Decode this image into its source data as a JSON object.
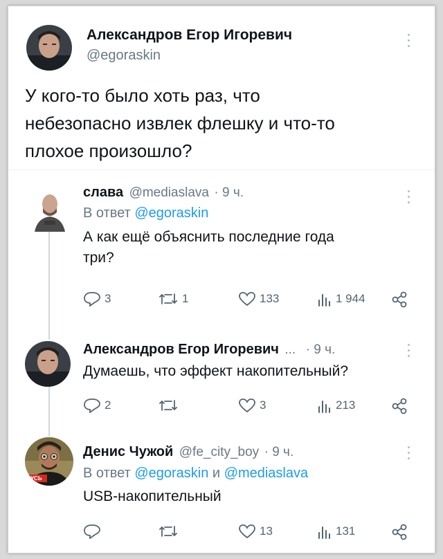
{
  "main_post": {
    "author_name": "Александров Егор Игоревич",
    "author_handle": "@egoraskin",
    "text_lines": [
      "У кого-то было хоть раз, что",
      "небезопасно извлек флешку и что-то",
      "плохое произошло?"
    ]
  },
  "replies": [
    {
      "author_name": "слава",
      "author_handle": "@mediaslava",
      "time": "· 9 ч.",
      "reply_prefix": "В ответ",
      "reply_to": "@egoraskin",
      "text_lines": [
        "А как ещё объяснить последние года",
        "три?"
      ],
      "replies_count": "3",
      "reposts_count": "1",
      "likes_count": "133",
      "views_count": "1 944"
    },
    {
      "author_name": "Александров Егор Игоревич",
      "author_ellipsis": "...",
      "time": "· 9 ч.",
      "text_lines": [
        "Думаешь, что эффект накопительный?"
      ],
      "replies_count": "2",
      "likes_count": "3",
      "views_count": "213"
    },
    {
      "author_name": "Денис Чужой",
      "author_handle": "@fe_city_boy",
      "time": "· 9 ч.",
      "reply_prefix": "В ответ",
      "reply_to": "@egoraskin",
      "reply_and": "и",
      "reply_to_2": "@mediaslava",
      "text_lines": [
        "USB-накопительный"
      ],
      "likes_count": "13",
      "views_count": "131",
      "avatar_badge": "КУСЬ"
    }
  ],
  "colors": {
    "accent": "#1d9bf0",
    "secondary_text": "#6b7785",
    "icon_gray": "#536471"
  }
}
